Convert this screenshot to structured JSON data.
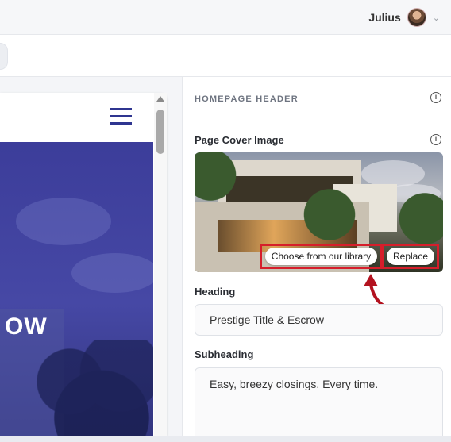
{
  "user": {
    "name": "Julius"
  },
  "panel": {
    "section_title": "HOMEPAGE HEADER",
    "cover_label": "Page Cover Image",
    "choose_library": "Choose from our library",
    "replace": "Replace",
    "heading_label": "Heading",
    "heading_value": "Prestige Title & Escrow",
    "subheading_label": "Subheading",
    "subheading_value": "Easy, breezy closings. Every time."
  },
  "preview": {
    "hero_text": "OW"
  },
  "colors": {
    "accent": "#2f3590",
    "highlight": "#d61e2b"
  }
}
